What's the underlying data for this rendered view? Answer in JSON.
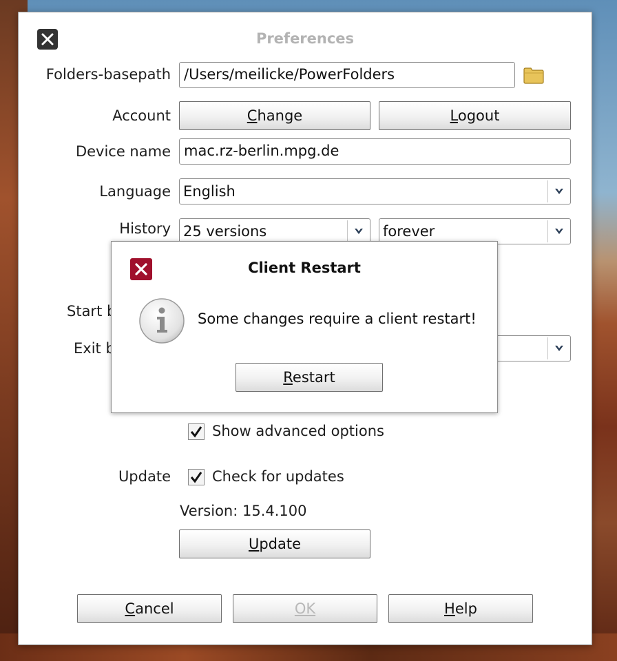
{
  "window": {
    "title": "Preferences"
  },
  "form": {
    "folders_basepath": {
      "label": "Folders-basepath",
      "value": "/Users/meilicke/PowerFolders"
    },
    "account": {
      "label": "Account",
      "change_prefix": "",
      "change_u": "C",
      "change_rest": "hange",
      "logout_u": "L",
      "logout_rest": "ogout"
    },
    "device_name": {
      "label": "Device name",
      "value": "mac.rz-berlin.mpg.de"
    },
    "language": {
      "label": "Language",
      "value": "English"
    },
    "history": {
      "label": "History",
      "versions": "25 versions",
      "duration": "forever"
    },
    "start_label_partial": "Start b",
    "exit_label_partial": "Exit b",
    "show_advanced": {
      "label": "Show advanced options",
      "checked": true
    },
    "update": {
      "label": "Update",
      "check_label": "Check for updates",
      "checked": true,
      "version_text": "Version: 15.4.100",
      "button_u": "U",
      "button_rest": "pdate"
    }
  },
  "footer": {
    "cancel_u": "C",
    "cancel_rest": "ancel",
    "ok_label": "OK",
    "help_u": "H",
    "help_rest": "elp"
  },
  "dialog": {
    "title": "Client Restart",
    "message": "Some changes require a client restart!",
    "restart_u": "R",
    "restart_rest": "estart"
  },
  "colors": {
    "dialog_close": "#a0102c",
    "window_close": "#333333"
  }
}
